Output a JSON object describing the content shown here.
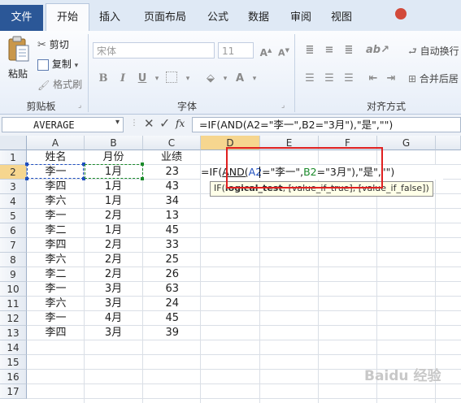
{
  "tabs": [
    {
      "label": "文件"
    },
    {
      "label": "开始"
    },
    {
      "label": "插入"
    },
    {
      "label": "页面布局"
    },
    {
      "label": "公式"
    },
    {
      "label": "数据"
    },
    {
      "label": "审阅"
    },
    {
      "label": "视图"
    }
  ],
  "ribbon": {
    "clipboard": {
      "paste": "粘贴",
      "cut": "剪切",
      "copy": "复制",
      "format_painter": "格式刷",
      "group_label": "剪贴板"
    },
    "font": {
      "font_name": "宋体",
      "font_size": "11",
      "group_label": "字体"
    },
    "alignment": {
      "wrap_text": "自动换行",
      "merge_center": "合并后居",
      "group_label": "对齐方式"
    }
  },
  "formula_bar": {
    "name_box": "AVERAGE",
    "fx": "fx",
    "formula": "=IF(AND(A2=\"李一\",B2=\"3月\"),\"是\",\"\")"
  },
  "sheet": {
    "columns": [
      "A",
      "B",
      "C",
      "D",
      "E",
      "F",
      "G"
    ],
    "rows": [
      "1",
      "2",
      "3",
      "4",
      "5",
      "6",
      "7",
      "8",
      "9",
      "10",
      "11",
      "12",
      "13",
      "14",
      "15",
      "16",
      "17"
    ],
    "header": {
      "a": "姓名",
      "b": "月份",
      "c": "业绩"
    },
    "data": [
      {
        "a": "李一",
        "b": "1月",
        "c": "23"
      },
      {
        "a": "李四",
        "b": "1月",
        "c": "43"
      },
      {
        "a": "李六",
        "b": "1月",
        "c": "34"
      },
      {
        "a": "李一",
        "b": "2月",
        "c": "13"
      },
      {
        "a": "李二",
        "b": "1月",
        "c": "45"
      },
      {
        "a": "李四",
        "b": "2月",
        "c": "33"
      },
      {
        "a": "李六",
        "b": "2月",
        "c": "25"
      },
      {
        "a": "李二",
        "b": "2月",
        "c": "26"
      },
      {
        "a": "李一",
        "b": "3月",
        "c": "63"
      },
      {
        "a": "李六",
        "b": "3月",
        "c": "24"
      },
      {
        "a": "李一",
        "b": "4月",
        "c": "45"
      },
      {
        "a": "李四",
        "b": "3月",
        "c": "39"
      }
    ],
    "editing": {
      "f1": "=IF(",
      "f2": "AND(",
      "f3": "A2",
      "f4": "=\"李一\",",
      "f5": "B2",
      "f6": "=\"3月\")",
      "f7": ",\"是\",\"\")"
    },
    "tooltip": {
      "fn": "IF(",
      "arg1": "logical_test",
      "rest": ", [value_if_true], [value_if_false])"
    }
  },
  "watermark": "Baidu 经验",
  "colors": {
    "file_tab": "#2b5797",
    "highlight_box": "#e02020",
    "ref_a2": "#1f4fbf",
    "ref_b2": "#1a8a2a"
  }
}
